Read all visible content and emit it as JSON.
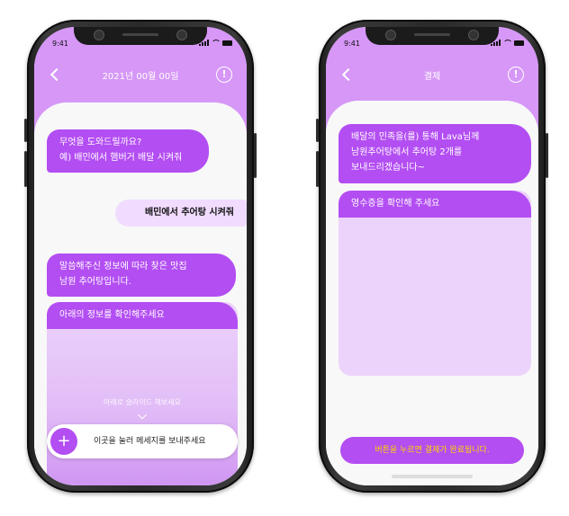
{
  "colors": {
    "accent": "#b34ef2",
    "header": "#d697f7",
    "panel": "#ecd3fb",
    "pay_text": "#ffd400"
  },
  "left": {
    "status_time": "9:41",
    "title": "2021년 00월 00일",
    "messages": [
      {
        "line1": "무엇을 도와드릴까요?",
        "line2": "예) 배민에서 햄버거 배달 시켜줘"
      },
      {
        "text": "배민에서 추어탕 시켜줘"
      },
      {
        "line1": "말씀해주신 정보에 따라 찾은 맛집",
        "line2": "남원 추어탕입니다."
      }
    ],
    "panel_caption": "아래의 정보를 확인해주세요",
    "slide_hint": "아래로 슬라이드 해보세요",
    "input_plus": "+",
    "input_placeholder": "이곳을 눌러 메세지를 보내주세요"
  },
  "right": {
    "status_time": "9:41",
    "title": "결제",
    "message": {
      "line1": "배달의 민족을(를) 통해 Lava님께",
      "line2": "남원추어탕에서 추어탕 2개를",
      "line3": "보내드리겠습니다~"
    },
    "panel_caption": "영수증을 확인해 주세요",
    "pay_button": "버튼을 누르면 결제가 완료됩니다."
  },
  "icons": {
    "back": "chevron-left-icon",
    "info": "info-circle-icon",
    "plus": "plus-icon",
    "down": "chevron-down-icon"
  }
}
